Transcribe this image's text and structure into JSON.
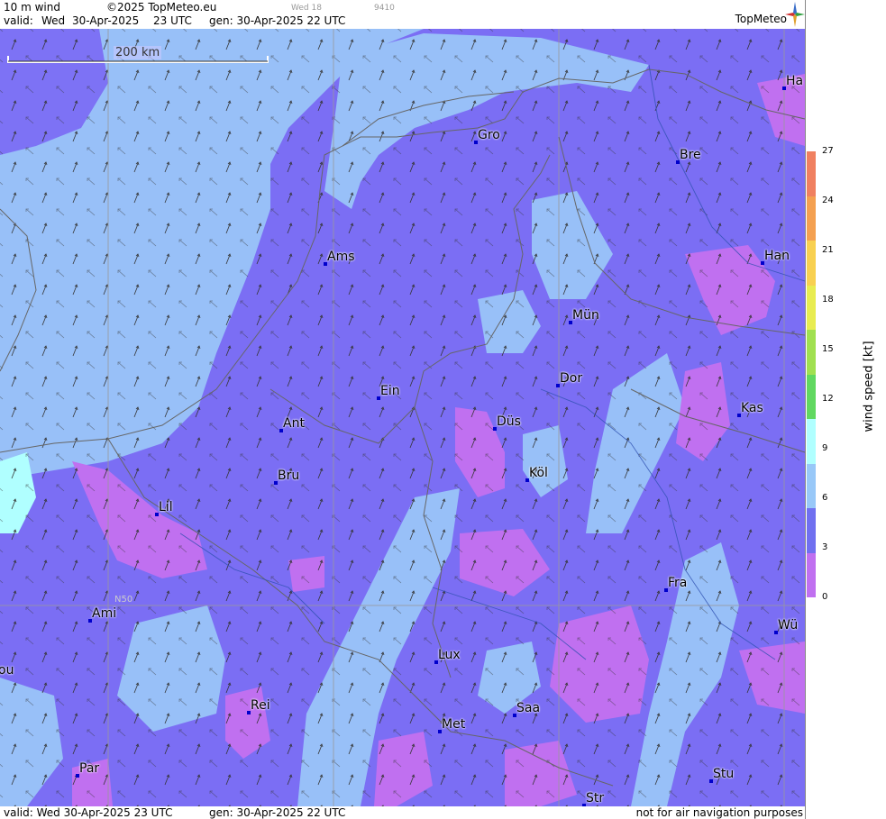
{
  "header": {
    "product": "10 m wind",
    "copyright": "©2025 TopMeteo.eu",
    "valid_label": "valid:",
    "valid_day": "Wed",
    "valid_date": "30-Apr-2025",
    "valid_time": "23 UTC",
    "gen": "gen: 30-Apr-2025 22 UTC",
    "run_code": "Wed 18",
    "run_id": "9410",
    "brand": "TopMeteo"
  },
  "footer": {
    "valid": "valid:  Wed  30-Apr-2025  23 UTC",
    "gen": "gen: 30-Apr-2025 22 UTC",
    "disclaimer": "not for air navigation purposes"
  },
  "scale_bar": {
    "label": "200 km"
  },
  "grid_label": "N50",
  "legend": {
    "title": "wind  speed  [kt]",
    "ticks": [
      "27",
      "24",
      "21",
      "18",
      "15",
      "12",
      "9",
      "6",
      "3",
      "0"
    ],
    "colors": [
      "#f08060",
      "#f4a050",
      "#f8d050",
      "#e8ec50",
      "#a0e050",
      "#60d860",
      "#b0ffff",
      "#98c8f8",
      "#7070f0",
      "#c070f0"
    ]
  },
  "cities": [
    {
      "name": "Ha"
    },
    {
      "name": "Gro"
    },
    {
      "name": "Bre"
    },
    {
      "name": "Ams"
    },
    {
      "name": "Han"
    },
    {
      "name": "Mün"
    },
    {
      "name": "Dor"
    },
    {
      "name": "Ein"
    },
    {
      "name": "Kas"
    },
    {
      "name": "Ant"
    },
    {
      "name": "Düs"
    },
    {
      "name": "Köl"
    },
    {
      "name": "Bru"
    },
    {
      "name": "Lil"
    },
    {
      "name": "Fra"
    },
    {
      "name": "Ami"
    },
    {
      "name": "Wü"
    },
    {
      "name": "ou"
    },
    {
      "name": "Lux"
    },
    {
      "name": "Rei"
    },
    {
      "name": "Saa"
    },
    {
      "name": "Met"
    },
    {
      "name": "Par"
    },
    {
      "name": "Stu"
    },
    {
      "name": "Str"
    }
  ],
  "colors": {
    "calm": "#c070f0",
    "light": "#7a6ef5",
    "moderate": "#98c0f8",
    "fresh": "#b0ffff",
    "city_marker": "#0000cc"
  }
}
